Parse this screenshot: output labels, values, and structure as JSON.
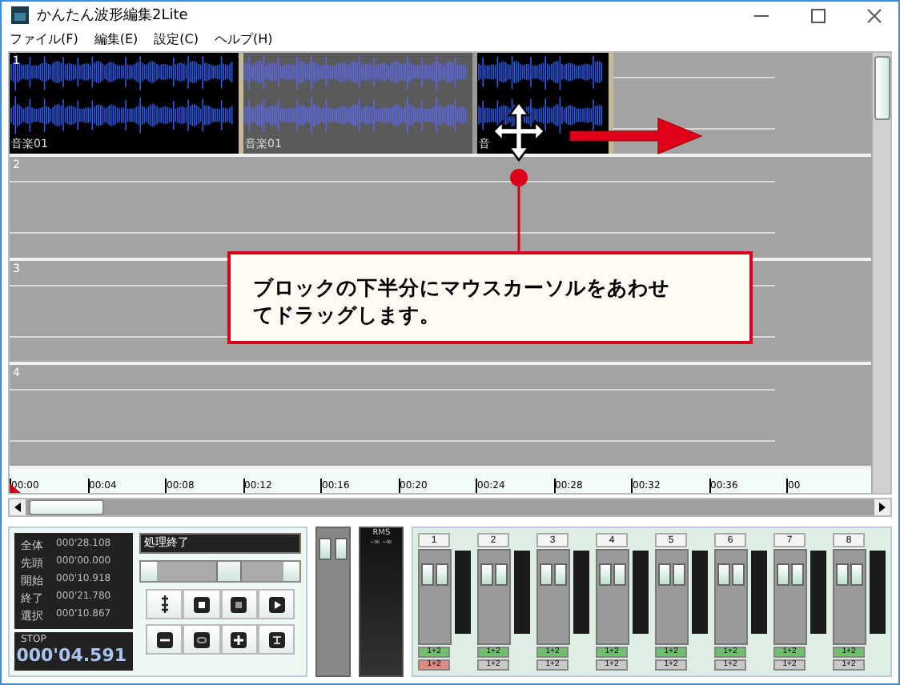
{
  "window": {
    "title": "かんたん波形編集2Lite"
  },
  "menu": [
    "ファイル(F)",
    "編集(E)",
    "設定(C)",
    "ヘルプ(H)"
  ],
  "tracks": [
    {
      "number": "1",
      "blocks": [
        {
          "label": "音楽01",
          "selected": true
        },
        {
          "label": "音楽01",
          "selected": false
        },
        {
          "label": "音",
          "selected": true
        }
      ]
    },
    {
      "number": "2"
    },
    {
      "number": "3"
    },
    {
      "number": "4"
    }
  ],
  "callout": {
    "text": "ブロックの下半分にマウスカーソルをあわせてドラッグします。"
  },
  "ruler": [
    "00:00",
    "00:04",
    "00:08",
    "00:12",
    "00:16",
    "00:20",
    "00:24",
    "00:28",
    "00:32",
    "00:36",
    "00"
  ],
  "info": [
    {
      "label": "全体",
      "value": "000'28.108"
    },
    {
      "label": "先頭",
      "value": "000'00.000"
    },
    {
      "label": "開始",
      "value": "000'10.918"
    },
    {
      "label": "終了",
      "value": "000'21.780"
    },
    {
      "label": "選択",
      "value": "000'10.867"
    }
  ],
  "transport": {
    "state": "STOP",
    "time": "000'04.591"
  },
  "status": "処理終了",
  "seek": {
    "level": 0.55
  },
  "buttons": [
    {
      "kind": "level"
    },
    {
      "kind": "stop"
    },
    {
      "kind": "record"
    },
    {
      "kind": "play"
    },
    {
      "kind": "minus"
    },
    {
      "kind": "loop"
    },
    {
      "kind": "plus"
    },
    {
      "kind": "export"
    }
  ],
  "rms": {
    "label": "RMS",
    "reading": "-∞ -∞"
  },
  "channels": [
    {
      "number": "1",
      "mix": "1+2",
      "mix2": "1+2",
      "on": true
    },
    {
      "number": "2",
      "mix": "1+2",
      "mix2": "1+2",
      "on": false
    },
    {
      "number": "3",
      "mix": "1+2",
      "mix2": "1+2",
      "on": false
    },
    {
      "number": "4",
      "mix": "1+2",
      "mix2": "1+2",
      "on": false
    },
    {
      "number": "5",
      "mix": "1+2",
      "mix2": "1+2",
      "on": false
    },
    {
      "number": "6",
      "mix": "1+2",
      "mix2": "1+2",
      "on": false
    },
    {
      "number": "7",
      "mix": "1+2",
      "mix2": "1+2",
      "on": false
    },
    {
      "number": "8",
      "mix": "1+2",
      "mix2": "1+2",
      "on": false
    }
  ]
}
